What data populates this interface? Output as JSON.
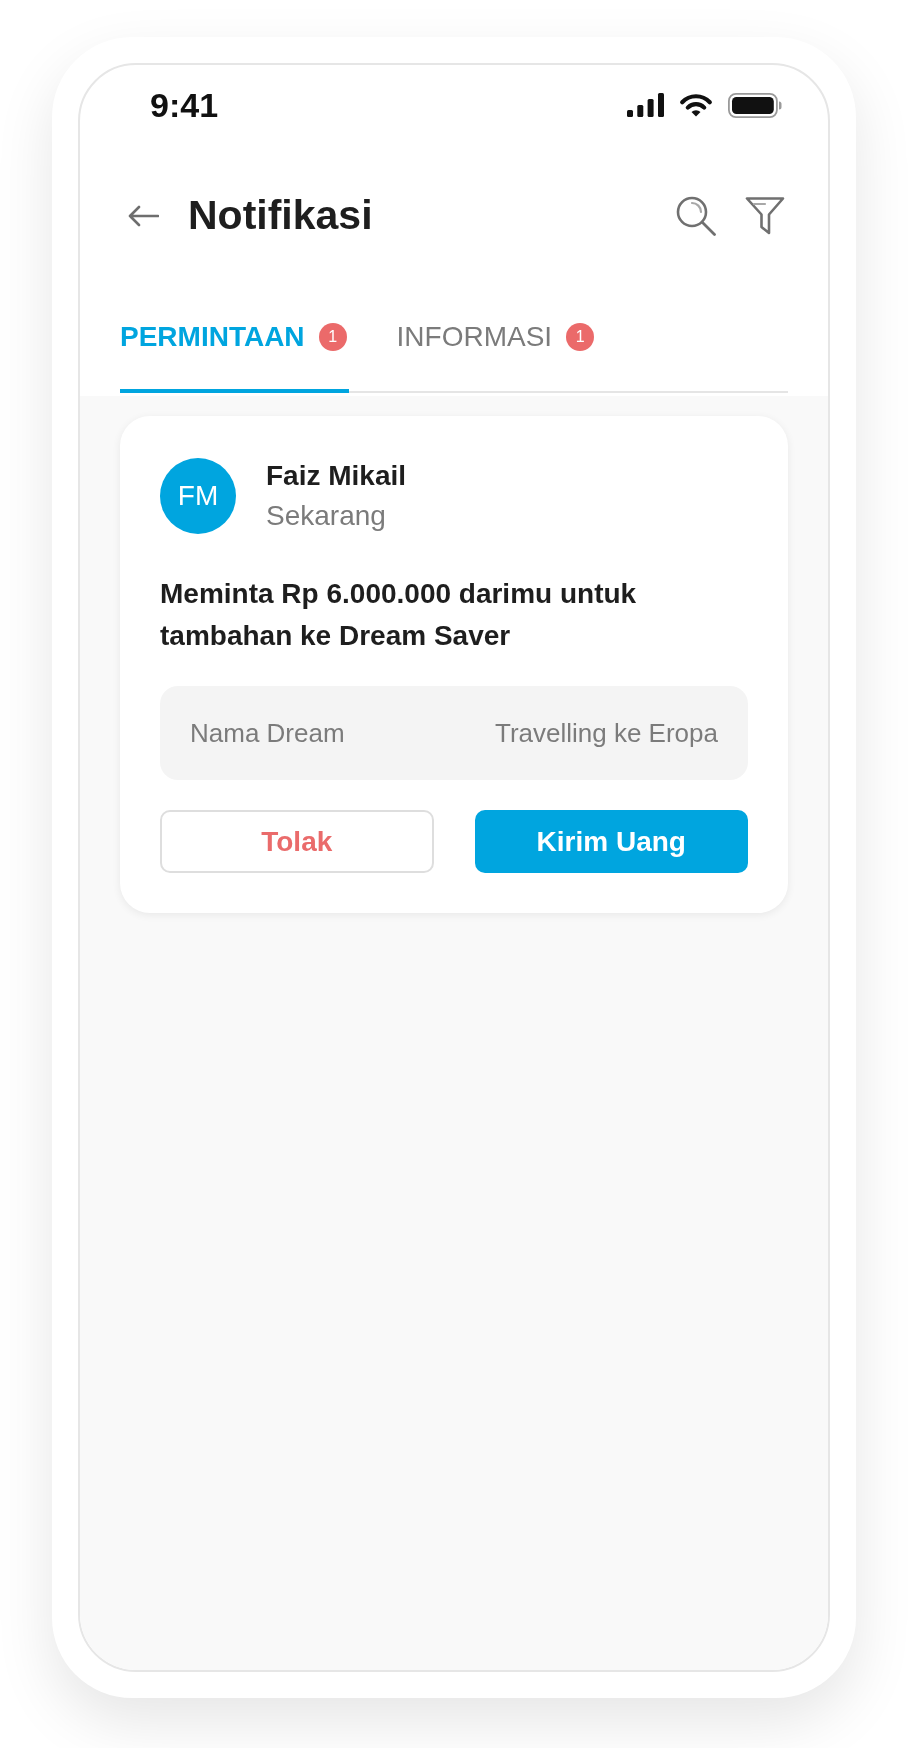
{
  "status_bar": {
    "time": "9:41"
  },
  "header": {
    "title": "Notifikasi"
  },
  "tabs": [
    {
      "label": "PERMINTAAN",
      "badge": "1",
      "selected": true
    },
    {
      "label": "INFORMASI",
      "badge": "1",
      "selected": false
    }
  ],
  "notifications": [
    {
      "sender_initials": "FM",
      "sender_name": "Faiz Mikail",
      "time": "Sekarang",
      "message": "Meminta Rp 6.000.000 darimu untuk tambahan ke Dream Saver",
      "detail": {
        "label": "Nama Dream",
        "value": "Travelling ke Eropa"
      },
      "actions": [
        {
          "label": "Tolak",
          "kind": "secondary"
        },
        {
          "label": "Kirim Uang",
          "kind": "primary"
        }
      ]
    }
  ]
}
